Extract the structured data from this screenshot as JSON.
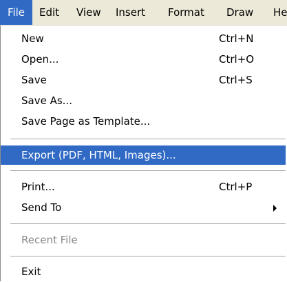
{
  "menubar": {
    "items": [
      "File",
      "Edit",
      "View",
      "Insert",
      "Format",
      "Draw",
      "He"
    ],
    "active": "File"
  },
  "file_menu": {
    "new": {
      "label": "New",
      "shortcut": "Ctrl+N"
    },
    "open": {
      "label": "Open...",
      "shortcut": "Ctrl+O"
    },
    "save": {
      "label": "Save",
      "shortcut": "Ctrl+S"
    },
    "save_as": {
      "label": "Save As..."
    },
    "save_template": {
      "label": "Save Page as Template..."
    },
    "export": {
      "label": "Export (PDF, HTML, Images)...",
      "highlighted": true
    },
    "print": {
      "label": "Print...",
      "shortcut": "Ctrl+P"
    },
    "send_to": {
      "label": "Send To",
      "submenu": true
    },
    "recent_file": {
      "label": "Recent File",
      "disabled": true
    },
    "exit": {
      "label": "Exit"
    }
  },
  "colors": {
    "highlight": "#316ac5",
    "menubar_bg": "#ece9d8",
    "disabled_text": "#8a8a8a"
  }
}
